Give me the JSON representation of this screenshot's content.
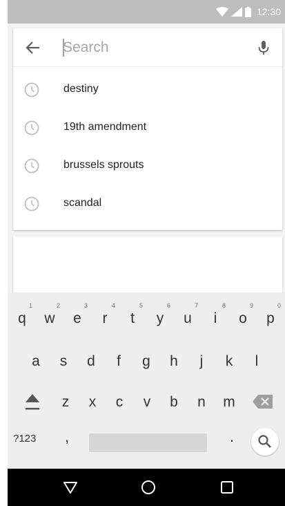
{
  "status_bar": {
    "time": "12:30"
  },
  "search": {
    "placeholder": "Search"
  },
  "suggestions": [
    {
      "text": "destiny"
    },
    {
      "text": "19th amendment"
    },
    {
      "text": "brussels sprouts"
    },
    {
      "text": "scandal"
    }
  ],
  "keyboard": {
    "row1": [
      {
        "key": "q",
        "hint": "1"
      },
      {
        "key": "w",
        "hint": "2"
      },
      {
        "key": "e",
        "hint": "3"
      },
      {
        "key": "r",
        "hint": "4"
      },
      {
        "key": "t",
        "hint": "5"
      },
      {
        "key": "y",
        "hint": "6"
      },
      {
        "key": "u",
        "hint": "7"
      },
      {
        "key": "i",
        "hint": "8"
      },
      {
        "key": "o",
        "hint": "9"
      },
      {
        "key": "p",
        "hint": "0"
      }
    ],
    "row2": [
      "a",
      "s",
      "d",
      "f",
      "g",
      "h",
      "j",
      "k",
      "l"
    ],
    "row3": [
      "z",
      "x",
      "c",
      "v",
      "b",
      "n",
      "m"
    ],
    "symbols_label": "?123",
    "comma": ",",
    "period": "."
  },
  "icons": {
    "back": "arrow-back-icon",
    "mic": "microphone-icon",
    "history": "clock-icon",
    "shift": "shift-icon",
    "backspace": "backspace-icon",
    "search_key": "search-icon",
    "nav_back": "triangle-back-icon",
    "nav_home": "circle-home-icon",
    "nav_recents": "square-recents-icon"
  }
}
